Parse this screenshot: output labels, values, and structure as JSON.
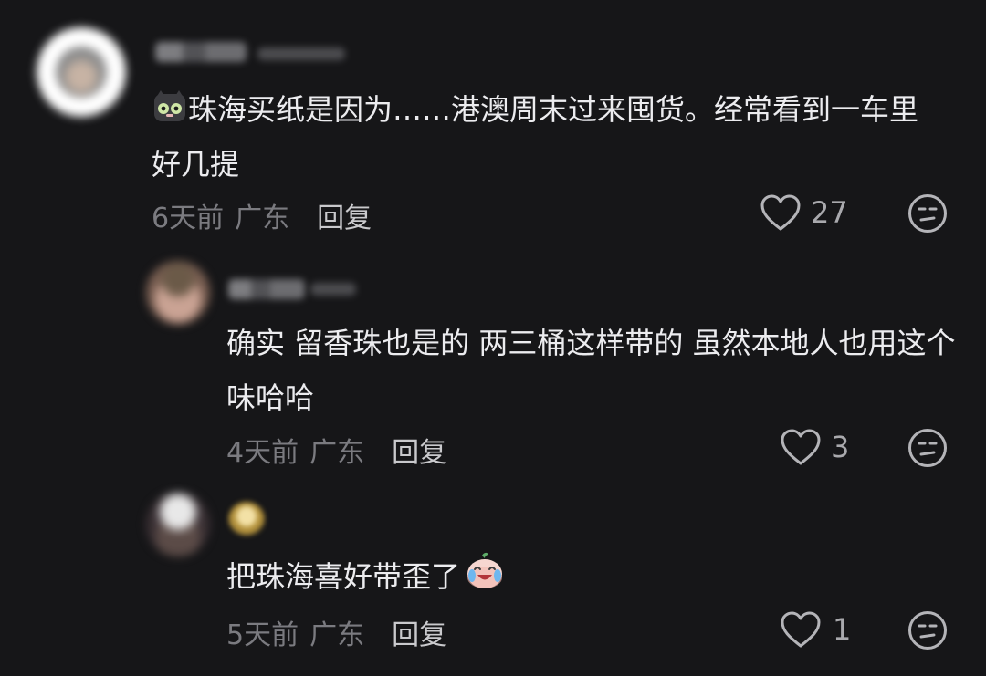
{
  "comments": [
    {
      "text": "珠海买纸是因为……港澳周末过来囤货。经常看到一车里好几提",
      "time": "6天前",
      "location": "广东",
      "reply_label": "回复",
      "likes": "27",
      "emoji_icon": "cat-emoji"
    },
    {
      "text": "确实 留香珠也是的 两三桶这样带的 虽然本地人也用这个味哈哈",
      "time": "4天前",
      "location": "广东",
      "reply_label": "回复",
      "likes": "3"
    },
    {
      "text": "把珠海喜好带歪了",
      "time": "5天前",
      "location": "广东",
      "reply_label": "回复",
      "likes": "1",
      "emoji_icon": "crying-laugh-emoji"
    }
  ],
  "colors": {
    "background": "#161618",
    "text": "#ececef",
    "meta": "#7b7b80",
    "reply": "#c9c9cc"
  }
}
